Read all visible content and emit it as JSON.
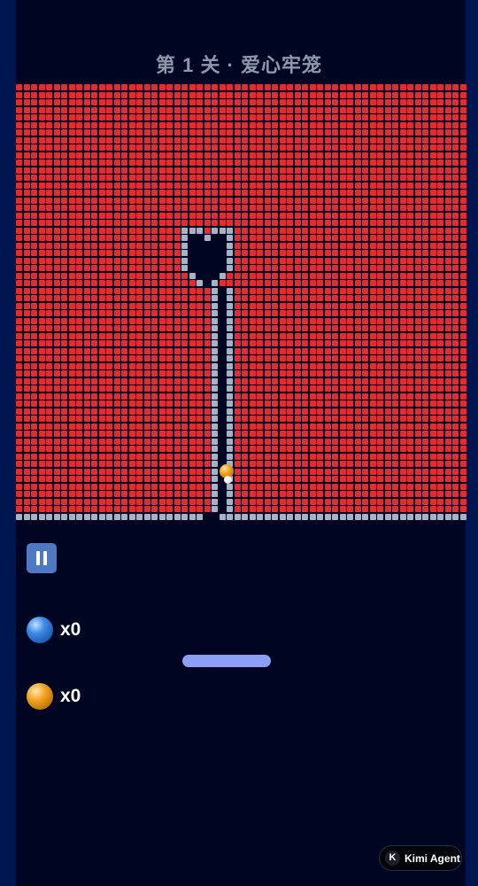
{
  "level": {
    "title": "第 1 关 · 爱心牢笼"
  },
  "board": {
    "brick_colors": {
      "red": "#e42b2f",
      "steel": "#a6b2c6"
    },
    "shape": "heart-cage"
  },
  "balls": [
    {
      "name": "orange-ball",
      "color": "#f0a21b"
    },
    {
      "name": "white-ball",
      "color": "#ffffff"
    }
  ],
  "controls": {
    "pause_icon": "pause-icon"
  },
  "powerups": {
    "blue": {
      "icon": "blue-ball-icon",
      "count_text": "x0"
    },
    "orange": {
      "icon": "orange-ball-icon",
      "count_text": "x0"
    }
  },
  "paddle": {
    "color": "#8a9ff5"
  },
  "badge": {
    "icon_text": "K",
    "label": "Kimi Agent"
  },
  "colors": {
    "background": "#000621",
    "side_bar": "#001650",
    "title": "#8e98ad",
    "pause_button": "#4f79c2"
  }
}
